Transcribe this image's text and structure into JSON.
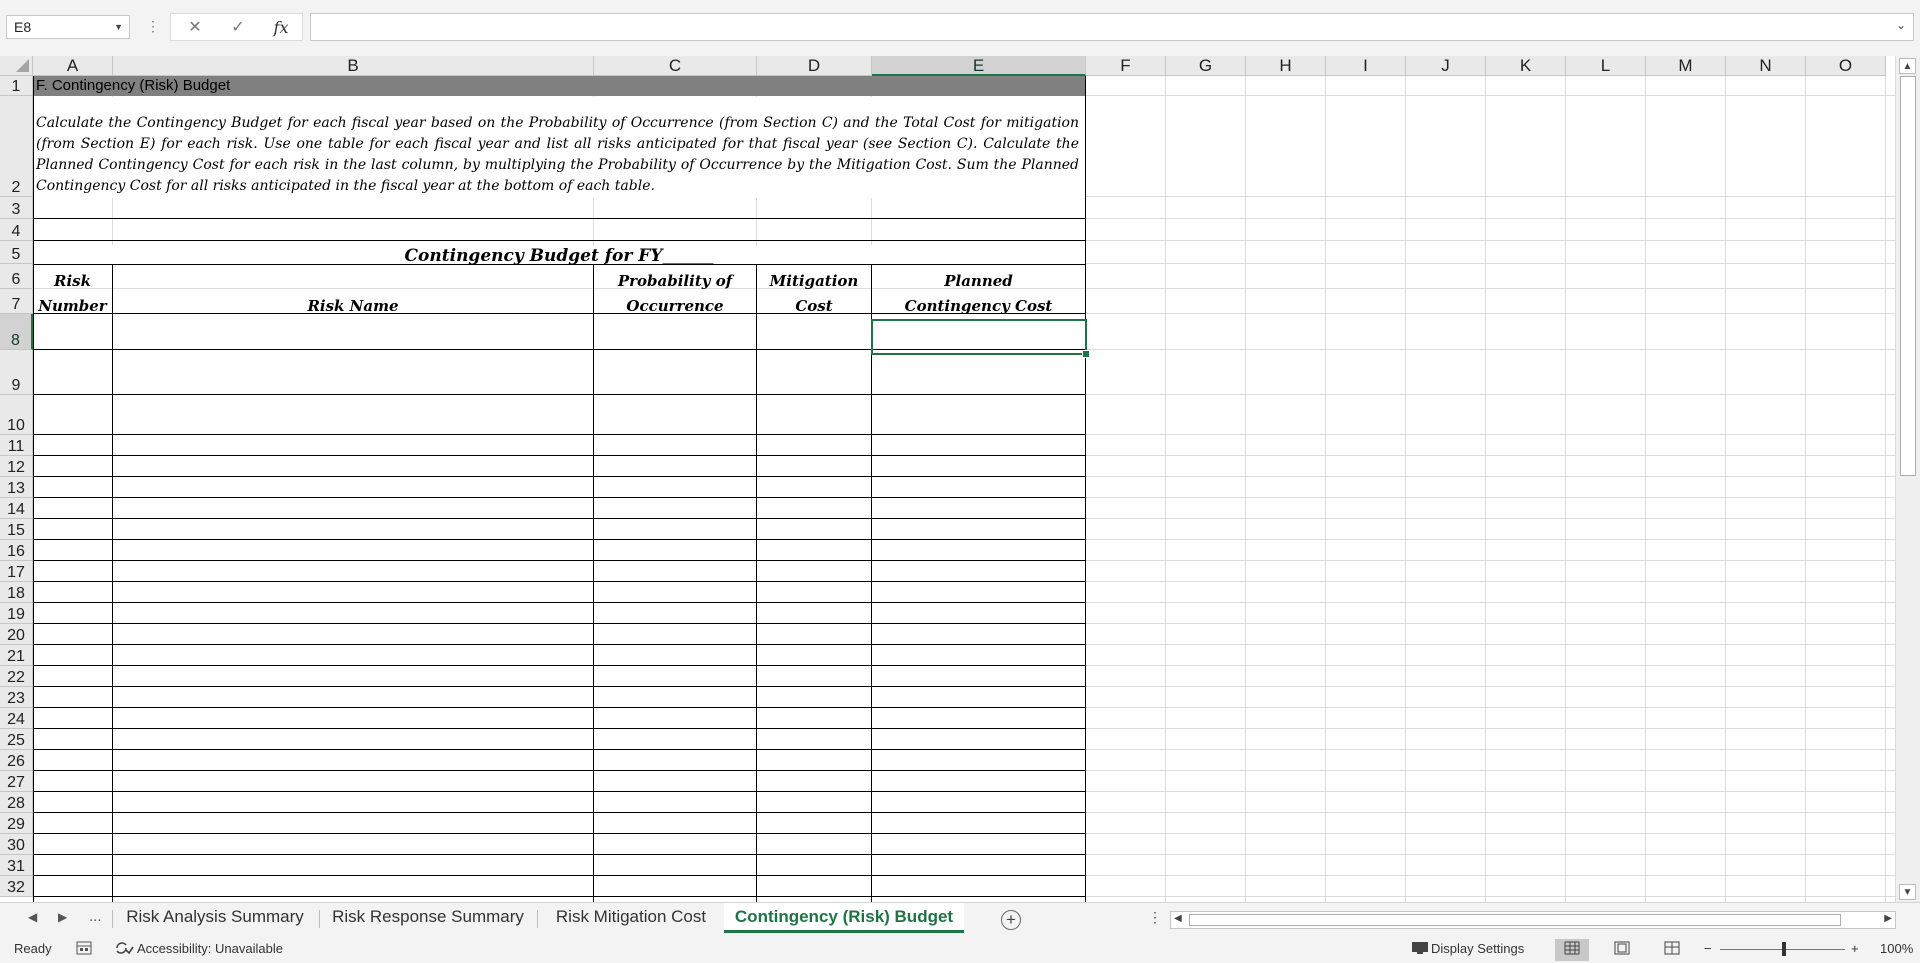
{
  "formula_bar": {
    "name_box": "E8",
    "cancel_icon": "✕",
    "enter_icon": "✓",
    "fx_label": "fx",
    "formula": ""
  },
  "columns": [
    "A",
    "B",
    "C",
    "D",
    "E",
    "F",
    "G",
    "H",
    "I",
    "J",
    "K",
    "L",
    "M",
    "N",
    "O"
  ],
  "selected_column": "E",
  "selected_row": "8",
  "rows": [
    "1",
    "2",
    "3",
    "4",
    "5",
    "6",
    "7",
    "8",
    "9",
    "10",
    "11",
    "12",
    "13",
    "14",
    "15",
    "16",
    "17",
    "18",
    "19",
    "20",
    "21",
    "22",
    "23",
    "24",
    "25",
    "26",
    "27",
    "28",
    "29",
    "30",
    "31",
    "32"
  ],
  "sheet": {
    "title": "F. Contingency (Risk) Budget",
    "description": "Calculate the Contingency Budget for each fiscal year based on the Probability of Occurrence (from Section C) and the Total Cost for mitigation (from Section E) for each risk.  Use one table for each fiscal year and list all risks anticipated for that fiscal year (see Section C).  Calculate the Planned Contingency Cost for each risk in the last column, by multiplying the Probability of Occurrence by the Mitigation Cost.  Sum the Planned Contingency Cost for all risks anticipated in the fiscal year at the bottom of each table.",
    "table_title": "Contingency Budget for FY______",
    "headers": {
      "risk_number_1": "Risk",
      "risk_number_2": "Number",
      "risk_name": "Risk Name",
      "probability_1": "Probability of",
      "probability_2": "Occurrence",
      "mitigation_1": "Mitigation",
      "mitigation_2": "Cost",
      "planned_1": "Planned",
      "planned_2": "Contingency Cost"
    }
  },
  "tabs": {
    "prev": "◀",
    "next": "▶",
    "more": "...",
    "items": [
      "Risk Analysis Summary",
      "Risk Response Summary",
      "Risk Mitigation Cost",
      "Contingency (Risk) Budget"
    ],
    "active": "Contingency (Risk) Budget",
    "add_icon": "+"
  },
  "status": {
    "ready": "Ready",
    "accessibility": "Accessibility: Unavailable",
    "display_settings": "Display Settings",
    "zoom_minus": "−",
    "zoom_plus": "+",
    "zoom": "100%"
  },
  "colors": {
    "accent": "#217346",
    "title_fill": "#808080"
  }
}
